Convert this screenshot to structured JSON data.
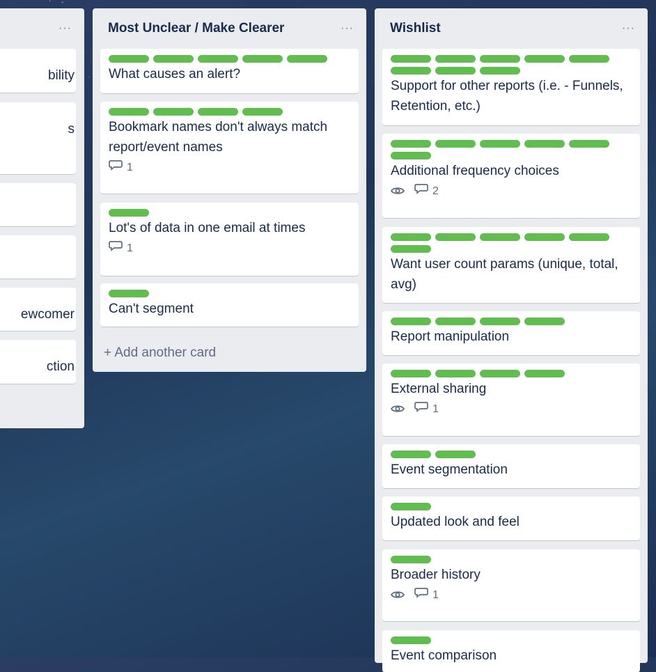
{
  "colors": {
    "label_green": "#61bd4f",
    "list_bg": "#ebecf0"
  },
  "lists": [
    {
      "title": "",
      "cards": [
        {
          "title": "bility"
        },
        {
          "title": "s"
        },
        {
          "title": ""
        },
        {
          "title": ""
        },
        {
          "title": "ewcomer"
        },
        {
          "title": "ction"
        }
      ]
    },
    {
      "title": "Most Unclear / Make Clearer",
      "add_label": "Add another card",
      "cards": [
        {
          "title": "What causes an alert?",
          "labels": 5
        },
        {
          "title": "Bookmark names don't always match report/event names",
          "labels": 4,
          "comments": "1"
        },
        {
          "title": "Lot's of data in one email at times",
          "labels": 1,
          "comments": "1"
        },
        {
          "title": "Can't segment",
          "labels": 1
        }
      ]
    },
    {
      "title": "Wishlist",
      "cards": [
        {
          "title": "Support for other reports (i.e. - Funnels, Retention, etc.)",
          "labels": 8
        },
        {
          "title": "Additional frequency choices",
          "labels": 6,
          "watch": true,
          "comments": "2"
        },
        {
          "title": "Want user count params (unique, total, avg)",
          "labels": 6
        },
        {
          "title": "Report manipulation",
          "labels": 4
        },
        {
          "title": "External sharing",
          "labels": 4,
          "watch": true,
          "comments": "1"
        },
        {
          "title": "Event segmentation",
          "labels": 2
        },
        {
          "title": "Updated look and feel",
          "labels": 1
        },
        {
          "title": "Broader history",
          "labels": 1,
          "watch": true,
          "comments": "1"
        },
        {
          "title": "Event comparison",
          "labels": 1
        }
      ]
    }
  ]
}
